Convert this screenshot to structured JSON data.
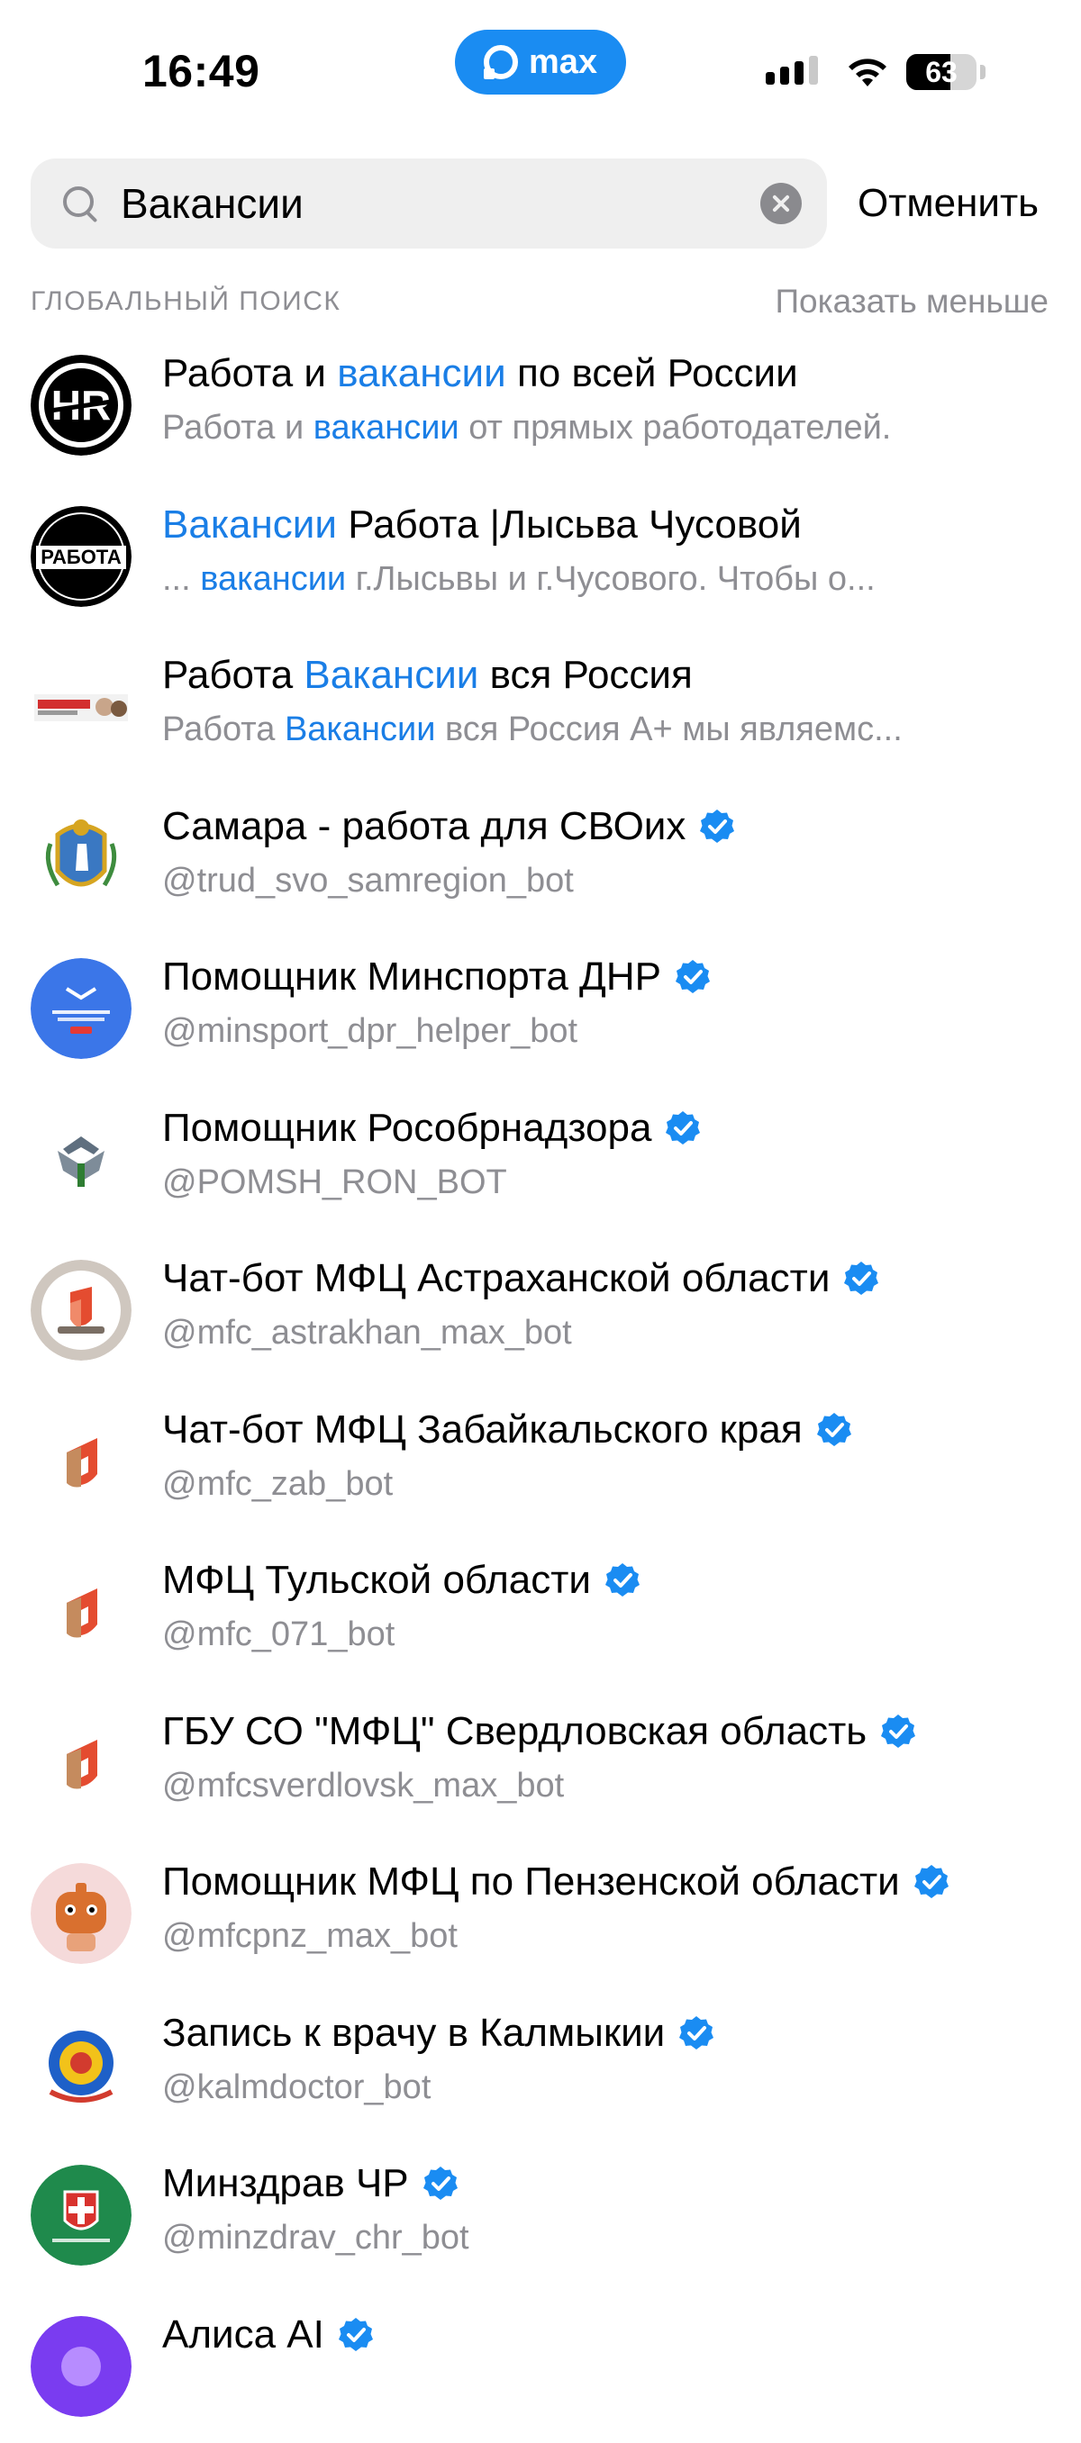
{
  "status_bar": {
    "time": "16:49",
    "app_badge": "max",
    "battery_percent": "63",
    "battery_level": 0.63
  },
  "search": {
    "value": "Вакансии",
    "cancel_label": "Отменить"
  },
  "section": {
    "title": "ГЛОБАЛЬНЫЙ ПОИСК",
    "toggle_label": "Показать меньше"
  },
  "colors": {
    "accent": "#1a7ee6",
    "secondary_text": "#8e8e93",
    "verified_badge": "#1a8cf2"
  },
  "results": [
    {
      "avatar_icon": "hr-logo-icon",
      "title": {
        "pre": "Работа и ",
        "hl": "вакансии",
        "post": " по всей России"
      },
      "subtitle": {
        "pre": "Работа и ",
        "hl": "вакансии",
        "post": " от прямых работодателей."
      },
      "verified": false
    },
    {
      "avatar_icon": "rabota-stamp-icon",
      "title": {
        "pre": "",
        "hl": "Вакансии",
        "post": " Работа |Лысьва Чусовой"
      },
      "subtitle": {
        "pre": "... ",
        "hl": "вакансии",
        "post": " г.Лысьвы и г.Чусового. Чтобы о..."
      },
      "verified": false
    },
    {
      "avatar_icon": "rabota-vakansii-banner-icon",
      "title": {
        "pre": "Работа ",
        "hl": "Вакансии",
        "post": " вся Россия"
      },
      "subtitle": {
        "pre": "Работа ",
        "hl": "Вакансии",
        "post": " вся Россия А+ мы являемс..."
      },
      "verified": false
    },
    {
      "avatar_icon": "samara-coat-of-arms-icon",
      "title": {
        "pre": "Самара - работа для СВОих",
        "hl": "",
        "post": ""
      },
      "subtitle": {
        "pre": "@trud_svo_samregion_bot",
        "hl": "",
        "post": ""
      },
      "verified": true
    },
    {
      "avatar_icon": "minsport-dnr-logo-icon",
      "title": {
        "pre": "Помощник Минспорта ДНР",
        "hl": "",
        "post": ""
      },
      "subtitle": {
        "pre": "@minsport_dpr_helper_bot",
        "hl": "",
        "post": ""
      },
      "verified": true
    },
    {
      "avatar_icon": "rosobrnadzor-emblem-icon",
      "title": {
        "pre": "Помощник Рособрнадзора",
        "hl": "",
        "post": ""
      },
      "subtitle": {
        "pre": "@POMSH_RON_BOT",
        "hl": "",
        "post": ""
      },
      "verified": true
    },
    {
      "avatar_icon": "mfc-astrakhan-logo-icon",
      "title": {
        "pre": "Чат-бот МФЦ Астраханской области",
        "hl": "",
        "post": ""
      },
      "subtitle": {
        "pre": "@mfc_astrakhan_max_bot",
        "hl": "",
        "post": ""
      },
      "verified": true
    },
    {
      "avatar_icon": "mfc-logo-icon",
      "title": {
        "pre": "Чат-бот МФЦ Забайкальского края",
        "hl": "",
        "post": ""
      },
      "subtitle": {
        "pre": "@mfc_zab_bot",
        "hl": "",
        "post": ""
      },
      "verified": true
    },
    {
      "avatar_icon": "mfc-logo-icon",
      "title": {
        "pre": "МФЦ Тульской области",
        "hl": "",
        "post": ""
      },
      "subtitle": {
        "pre": "@mfc_071_bot",
        "hl": "",
        "post": ""
      },
      "verified": true
    },
    {
      "avatar_icon": "mfc-logo-icon",
      "title": {
        "pre": "ГБУ СО \"МФЦ\" Свердловская область",
        "hl": "",
        "post": ""
      },
      "subtitle": {
        "pre": "@mfcsverdlovsk_max_bot",
        "hl": "",
        "post": ""
      },
      "verified": true
    },
    {
      "avatar_icon": "mfc-penza-mascot-icon",
      "title": {
        "pre": "Помощник МФЦ по Пензенской области",
        "hl": "",
        "post": ""
      },
      "subtitle": {
        "pre": "@mfcpnz_max_bot",
        "hl": "",
        "post": ""
      },
      "verified": true
    },
    {
      "avatar_icon": "kalmykia-emblem-icon",
      "title": {
        "pre": "Запись к врачу в Калмыкии",
        "hl": "",
        "post": ""
      },
      "subtitle": {
        "pre": "@kalmdoctor_bot",
        "hl": "",
        "post": ""
      },
      "verified": true
    },
    {
      "avatar_icon": "minzdrav-chr-logo-icon",
      "title": {
        "pre": "Минздрав ЧР",
        "hl": "",
        "post": ""
      },
      "subtitle": {
        "pre": "@minzdrav_chr_bot",
        "hl": "",
        "post": ""
      },
      "verified": true
    },
    {
      "avatar_icon": "alisa-ai-logo-icon",
      "title": {
        "pre": "Алиса AI",
        "hl": "",
        "post": ""
      },
      "subtitle": {
        "pre": "",
        "hl": "",
        "post": ""
      },
      "verified": true
    }
  ]
}
